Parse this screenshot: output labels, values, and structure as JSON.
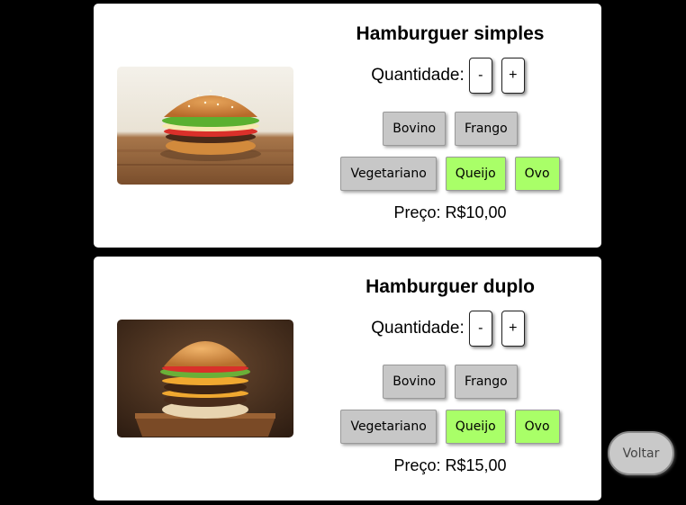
{
  "products": [
    {
      "name": "Hamburguer simples",
      "image_alt": "hamburger-photo",
      "quantity_label": "Quantidade:",
      "minus": "-",
      "plus": "+",
      "options_row1": [
        "Bovino",
        "Frango"
      ],
      "options_row2": [
        "Vegetariano",
        "Queijo",
        "Ovo"
      ],
      "price": "Preço: R$10,00"
    },
    {
      "name": "Hamburguer duplo",
      "image_alt": "double-hamburger-photo",
      "quantity_label": "Quantidade:",
      "minus": "-",
      "plus": "+",
      "options_row1": [
        "Bovino",
        "Frango"
      ],
      "options_row2": [
        "Vegetariano",
        "Queijo",
        "Ovo"
      ],
      "price": "Preço: R$15,00"
    }
  ],
  "back_button": "Voltar",
  "colors": {
    "page_background": "#000000",
    "card_background": "#ffffff",
    "option_default": "#c7c7c7",
    "option_selected": "#a9ff68"
  }
}
